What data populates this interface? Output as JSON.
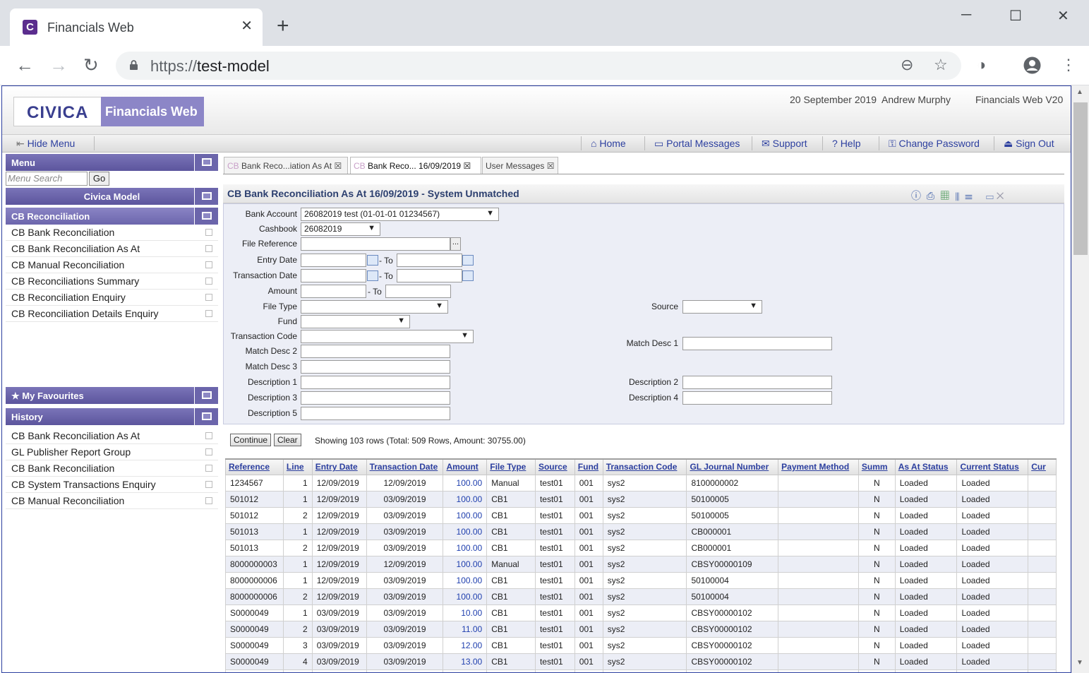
{
  "browser": {
    "tab_title": "Financials Web",
    "tab_favicon": "C",
    "url_scheme": "https://",
    "url_host": "test-model"
  },
  "header": {
    "logo_text": "CIVICA",
    "product": "Financials Web",
    "date": "20 September 2019",
    "user": "Andrew Murphy",
    "version": "Financials Web V20"
  },
  "toolbar": {
    "hide_menu": "Hide Menu",
    "home": "Home",
    "portal_messages": "Portal Messages",
    "support": "Support",
    "help": "Help",
    "change_password": "Change Password",
    "sign_out": "Sign Out"
  },
  "menu": {
    "title": "Menu",
    "search_placeholder": "Menu Search",
    "go": "Go",
    "group": "Civica Model",
    "section": "CB Reconciliation",
    "items": [
      "CB Bank Reconciliation",
      "CB Bank Reconciliation As At",
      "CB Manual Reconciliation",
      "CB Reconciliations Summary",
      "CB Reconciliation Enquiry",
      "CB Reconciliation Details Enquiry"
    ],
    "favourites": "My Favourites",
    "history_title": "History",
    "history": [
      "CB Bank Reconciliation As At",
      "GL Publisher Report Group",
      "CB Bank Reconciliation",
      "CB System Transactions Enquiry",
      "CB Manual Reconciliation"
    ]
  },
  "tabs": [
    {
      "prefix": "CB",
      "label": "Bank Reco...iation As At"
    },
    {
      "prefix": "CB",
      "label": "Bank Reco... 16/09/2019"
    },
    {
      "prefix": "",
      "label": "User Messages"
    }
  ],
  "panel": {
    "title": "CB Bank Reconciliation As At 16/09/2019 - System Unmatched"
  },
  "filters": {
    "bank_account_label": "Bank Account",
    "bank_account_value": "26082019 test (01-01-01 01234567)",
    "cashbook_label": "Cashbook",
    "cashbook_value": "26082019",
    "file_reference_label": "File Reference",
    "entry_date_label": "Entry Date",
    "transaction_date_label": "Transaction Date",
    "amount_label": "Amount",
    "to_label": "- To",
    "file_type_label": "File Type",
    "fund_label": "Fund",
    "transaction_code_label": "Transaction Code",
    "match_desc2_label": "Match Desc 2",
    "match_desc3_label": "Match Desc 3",
    "description1_label": "Description 1",
    "description3_label": "Description 3",
    "description5_label": "Description 5",
    "source_label": "Source",
    "match_desc1_label": "Match Desc 1",
    "description2_label": "Description 2",
    "description4_label": "Description 4",
    "dots": "..."
  },
  "actions": {
    "continue": "Continue",
    "clear": "Clear",
    "showing": "Showing 103 rows (Total: 509 Rows, Amount: 30755.00)"
  },
  "table": {
    "columns": [
      "Reference",
      "Line",
      "Entry Date",
      "Transaction Date",
      "Amount",
      "File Type",
      "Source",
      "Fund",
      "Transaction Code",
      "GL Journal Number",
      "Payment Method",
      "Summ",
      "As At Status",
      "Current Status",
      "Cur"
    ],
    "rows": [
      [
        "1234567",
        "1",
        "12/09/2019",
        "12/09/2019",
        "100.00",
        "Manual",
        "test01",
        "001",
        "sys2",
        "8100000002",
        "",
        "N",
        "Loaded",
        "Loaded",
        ""
      ],
      [
        "501012",
        "1",
        "12/09/2019",
        "03/09/2019",
        "100.00",
        "CB1",
        "test01",
        "001",
        "sys2",
        "50100005",
        "",
        "N",
        "Loaded",
        "Loaded",
        ""
      ],
      [
        "501012",
        "2",
        "12/09/2019",
        "03/09/2019",
        "100.00",
        "CB1",
        "test01",
        "001",
        "sys2",
        "50100005",
        "",
        "N",
        "Loaded",
        "Loaded",
        ""
      ],
      [
        "501013",
        "1",
        "12/09/2019",
        "03/09/2019",
        "100.00",
        "CB1",
        "test01",
        "001",
        "sys2",
        "CB000001",
        "",
        "N",
        "Loaded",
        "Loaded",
        ""
      ],
      [
        "501013",
        "2",
        "12/09/2019",
        "03/09/2019",
        "100.00",
        "CB1",
        "test01",
        "001",
        "sys2",
        "CB000001",
        "",
        "N",
        "Loaded",
        "Loaded",
        ""
      ],
      [
        "8000000003",
        "1",
        "12/09/2019",
        "12/09/2019",
        "100.00",
        "Manual",
        "test01",
        "001",
        "sys2",
        "CBSY00000109",
        "",
        "N",
        "Loaded",
        "Loaded",
        ""
      ],
      [
        "8000000006",
        "1",
        "12/09/2019",
        "03/09/2019",
        "100.00",
        "CB1",
        "test01",
        "001",
        "sys2",
        "50100004",
        "",
        "N",
        "Loaded",
        "Loaded",
        ""
      ],
      [
        "8000000006",
        "2",
        "12/09/2019",
        "03/09/2019",
        "100.00",
        "CB1",
        "test01",
        "001",
        "sys2",
        "50100004",
        "",
        "N",
        "Loaded",
        "Loaded",
        ""
      ],
      [
        "S0000049",
        "1",
        "03/09/2019",
        "03/09/2019",
        "10.00",
        "CB1",
        "test01",
        "001",
        "sys2",
        "CBSY00000102",
        "",
        "N",
        "Loaded",
        "Loaded",
        ""
      ],
      [
        "S0000049",
        "2",
        "03/09/2019",
        "03/09/2019",
        "11.00",
        "CB1",
        "test01",
        "001",
        "sys2",
        "CBSY00000102",
        "",
        "N",
        "Loaded",
        "Loaded",
        ""
      ],
      [
        "S0000049",
        "3",
        "03/09/2019",
        "03/09/2019",
        "12.00",
        "CB1",
        "test01",
        "001",
        "sys2",
        "CBSY00000102",
        "",
        "N",
        "Loaded",
        "Loaded",
        ""
      ],
      [
        "S0000049",
        "4",
        "03/09/2019",
        "03/09/2019",
        "13.00",
        "CB1",
        "test01",
        "001",
        "sys2",
        "CBSY00000102",
        "",
        "N",
        "Loaded",
        "Loaded",
        ""
      ],
      [
        "",
        "",
        "",
        "",
        "",
        "",
        "",
        "",
        "",
        "",
        "",
        "",
        "",
        "",
        ""
      ]
    ]
  },
  "colors": {
    "accent": "#5c559d",
    "link": "#2c3f9f",
    "row_alt": "#eceef6"
  }
}
